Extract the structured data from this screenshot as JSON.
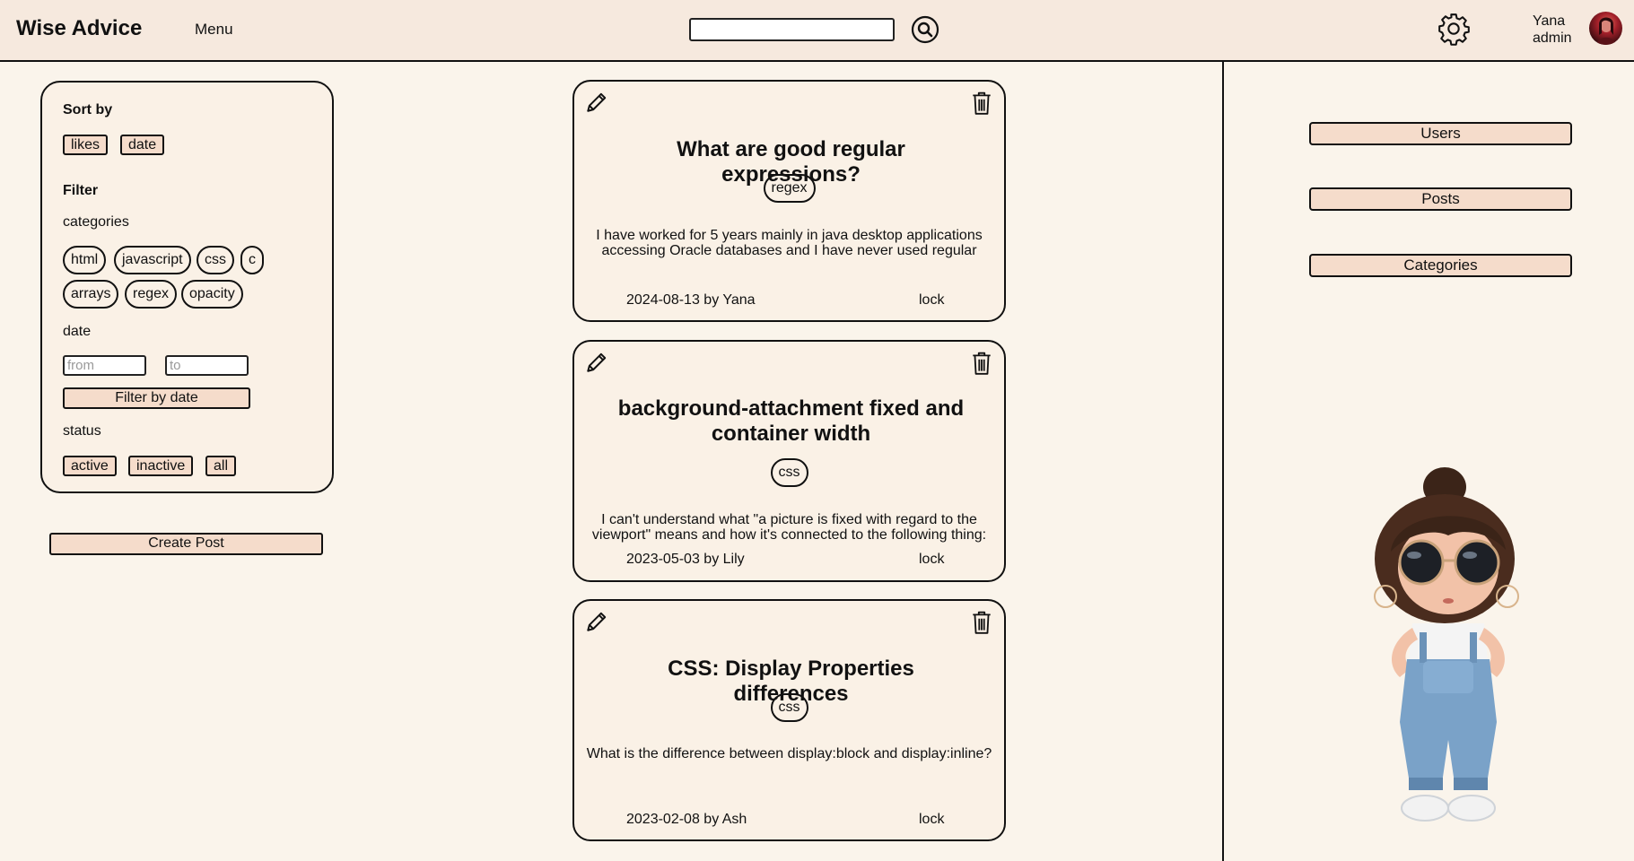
{
  "header": {
    "logo": "Wise Advice",
    "menu_label": "Menu",
    "search_value": "",
    "user_name": "Yana",
    "user_role": "admin"
  },
  "sidebar": {
    "sort_heading": "Sort by",
    "sort_options": [
      "likes",
      "date"
    ],
    "filter_heading": "Filter",
    "categories_label": "categories",
    "categories": [
      "html",
      "javascript",
      "css",
      "c",
      "arrays",
      "regex",
      "opacity"
    ],
    "date_label": "date",
    "date_from_placeholder": "from",
    "date_to_placeholder": "to",
    "filter_by_date_label": "Filter by date",
    "status_label": "status",
    "status_options": [
      "active",
      "inactive",
      "all"
    ],
    "create_post_label": "Create Post"
  },
  "posts": [
    {
      "title": "What are good regular expressions?",
      "tag": "regex",
      "body": "I have worked for 5 years mainly in java desktop applications accessing Oracle databases and I have never used regular",
      "meta": "2024-08-13 by Yana",
      "lock": "lock"
    },
    {
      "title": "background-attachment fixed and container width",
      "tag": "css",
      "body": "I can't understand what \"a picture is fixed with regard to the viewport\" means and how it's connected to the following thing:",
      "meta": "2023-05-03 by Lily",
      "lock": "lock"
    },
    {
      "title": "CSS: Display Properties differences",
      "tag": "css",
      "body": "What is the difference between display:block and display:inline?",
      "meta": "2023-02-08 by Ash",
      "lock": "lock"
    }
  ],
  "admin_nav": [
    "Users",
    "Posts",
    "Categories"
  ],
  "colors": {
    "page_bg": "#faf4eb",
    "header_bg": "#f6e9de",
    "button_bg": "#f5dccb",
    "border": "#111111"
  }
}
